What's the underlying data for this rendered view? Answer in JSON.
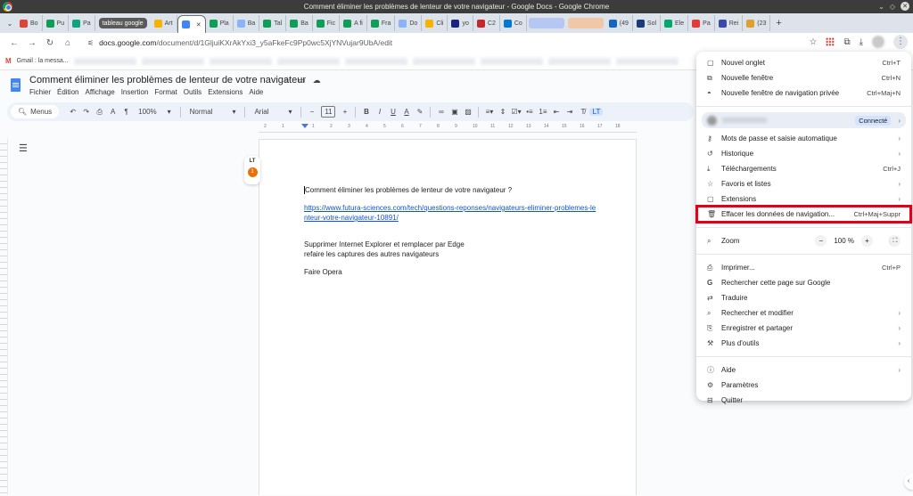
{
  "window": {
    "title": "Comment éliminer les problèmes de lenteur de votre navigateur - Google Docs - Google Chrome"
  },
  "tabs": [
    {
      "label": "Bo",
      "icon": "gmail-icon",
      "color": "#db4437"
    },
    {
      "label": "Pu",
      "icon": "sheets-icon",
      "color": "#0f9d58"
    },
    {
      "label": "Pa",
      "icon": "chatgpt-icon",
      "color": "#10a37f"
    },
    {
      "label": "tableau google",
      "type": "group"
    },
    {
      "label": "Art",
      "icon": "drive-icon",
      "color": "#f4b400"
    },
    {
      "label": "",
      "icon": "docs-icon",
      "color": "#4285f4",
      "active": true
    },
    {
      "label": "Pla",
      "icon": "sheets-icon",
      "color": "#0f9d58"
    },
    {
      "label": "Ba",
      "icon": "globe-icon",
      "color": "#8ab4f8"
    },
    {
      "label": "Tal",
      "icon": "sheets-icon",
      "color": "#0f9d58"
    },
    {
      "label": "Ba",
      "icon": "sheets-icon",
      "color": "#0f9d58"
    },
    {
      "label": "Fic",
      "icon": "sheets-icon",
      "color": "#0f9d58"
    },
    {
      "label": "A fi",
      "icon": "sheets-icon",
      "color": "#0f9d58"
    },
    {
      "label": "Fra",
      "icon": "sheets-icon",
      "color": "#0f9d58"
    },
    {
      "label": "Do",
      "icon": "globe-icon",
      "color": "#8ab4f8"
    },
    {
      "label": "Cli",
      "icon": "drive-icon",
      "color": "#f4b400"
    },
    {
      "label": "yo",
      "icon": "yoast-icon",
      "color": "#1a237e"
    },
    {
      "label": "C2",
      "icon": "kb-icon",
      "color": "#c62828"
    },
    {
      "label": "Co",
      "icon": "outlook-icon",
      "color": "#0078d4"
    },
    {
      "label": "",
      "type": "blurred"
    },
    {
      "label": "",
      "type": "blurred2"
    },
    {
      "label": "(49",
      "icon": "bird-icon",
      "color": "#1565c0"
    },
    {
      "label": "Sol",
      "icon": "app-icon",
      "color": "#1a3a7a"
    },
    {
      "label": "Ele",
      "icon": "elementor-icon",
      "color": "#00a86b"
    },
    {
      "label": "Pa",
      "icon": "diamond-icon",
      "color": "#e53935"
    },
    {
      "label": "Rei",
      "icon": "app-icon",
      "color": "#3949ab"
    },
    {
      "label": "(23",
      "icon": "ta-icon",
      "color": "#e0a030"
    }
  ],
  "toolbar": {
    "back": "←",
    "forward": "→",
    "reload": "C",
    "home": "⌂",
    "url_host": "docs.google.com",
    "url_path": "/document/d/1GljuiKXrAkYxi3_y5aFkeFc9Pp0wc5XjYNVujar9UbA/edit"
  },
  "bookmarks": {
    "first": "Gmail : la messa..."
  },
  "doc": {
    "title": "Comment éliminer les problèmes de lenteur de votre navigateur",
    "menu": [
      "Fichier",
      "Édition",
      "Affichage",
      "Insertion",
      "Format",
      "Outils",
      "Extensions",
      "Aide"
    ],
    "menus_search": "Menus",
    "zoom": "100%",
    "style": "Normal",
    "font": "Arial",
    "font_size": "11",
    "ruler_ticks": [
      "2",
      "1",
      "1",
      "2",
      "3",
      "4",
      "5",
      "6",
      "7",
      "8",
      "9",
      "10",
      "11",
      "12",
      "13",
      "14",
      "15",
      "16",
      "17",
      "18"
    ],
    "widget_label": "LT",
    "widget_badge": "1",
    "body": {
      "line1": "Comment éliminer les problèmes de lenteur de votre navigateur ?",
      "link": "https://www.futura-sciences.com/tech/questions-reponses/navigateurs-eliminer-problemes-lenteur-votre-navigateur-10891/",
      "line3": "Supprimer Internet Explorer et remplacer par Edge",
      "line4": "refaire les captures des autres navigateurs",
      "line5": "Faire Opera"
    }
  },
  "chrome_menu": {
    "group1": [
      {
        "label": "Nouvel onglet",
        "shortcut": "Ctrl+T",
        "icon": "new-tab-icon"
      },
      {
        "label": "Nouvelle fenêtre",
        "shortcut": "Ctrl+N",
        "icon": "new-window-icon"
      },
      {
        "label": "Nouvelle fenêtre de navigation privée",
        "shortcut": "Ctrl+Maj+N",
        "icon": "incognito-icon"
      }
    ],
    "profile": {
      "status": "Connecté"
    },
    "group2": [
      {
        "label": "Mots de passe et saisie automatique",
        "shortcut": "",
        "icon": "key-icon",
        "submenu": true
      },
      {
        "label": "Historique",
        "shortcut": "",
        "icon": "history-icon",
        "submenu": true
      },
      {
        "label": "Téléchargements",
        "shortcut": "Ctrl+J",
        "icon": "download-icon"
      },
      {
        "label": "Favoris et listes",
        "shortcut": "",
        "icon": "star-icon",
        "submenu": true
      },
      {
        "label": "Extensions",
        "shortcut": "",
        "icon": "puzzle-icon",
        "submenu": true
      },
      {
        "label": "Effacer les données de navigation...",
        "shortcut": "Ctrl+Maj+Suppr",
        "icon": "trash-icon",
        "highlighted": true
      }
    ],
    "zoom": {
      "label": "Zoom",
      "value": "100 %",
      "minus": "−",
      "plus": "+"
    },
    "group3": [
      {
        "label": "Imprimer...",
        "shortcut": "Ctrl+P",
        "icon": "print-icon"
      },
      {
        "label": "Rechercher cette page sur Google",
        "shortcut": "",
        "icon": "google-icon"
      },
      {
        "label": "Traduire",
        "shortcut": "",
        "icon": "translate-icon"
      },
      {
        "label": "Rechercher et modifier",
        "shortcut": "",
        "icon": "find-icon",
        "submenu": true
      },
      {
        "label": "Enregistrer et partager",
        "shortcut": "",
        "icon": "save-share-icon",
        "submenu": true
      },
      {
        "label": "Plus d'outils",
        "shortcut": "",
        "icon": "toolbox-icon",
        "submenu": true
      }
    ],
    "group4": [
      {
        "label": "Aide",
        "shortcut": "",
        "icon": "help-icon",
        "submenu": true
      },
      {
        "label": "Paramètres",
        "shortcut": "",
        "icon": "settings-icon"
      },
      {
        "label": "Quitter",
        "shortcut": "",
        "icon": "exit-icon"
      }
    ],
    "highlight_color": "#e3001b"
  }
}
